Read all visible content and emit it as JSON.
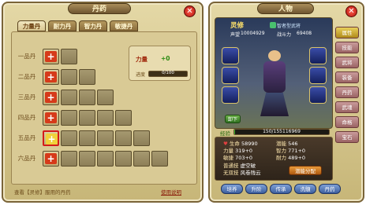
{
  "left_panel": {
    "title": "丹药",
    "tabs": [
      "力量丹",
      "耐力丹",
      "智力丹",
      "敏捷丹"
    ],
    "rows": [
      "一品丹",
      "二品丹",
      "三品丹",
      "四品丹",
      "五品丹",
      "六品丹"
    ],
    "info": {
      "attr_label": "力量",
      "attr_value": "+0",
      "progress_label": "进度",
      "progress_value": "0/100",
      "progress_fraction": 0
    },
    "footer_text": "查看【灵修】服用的丹药",
    "footer_link": "使用说明"
  },
  "right_panel": {
    "title": "人物",
    "char_name": "灵修",
    "prestige_label": "声望",
    "prestige_value": "10004929",
    "class_name": "智者型武将",
    "combat_label": "战斗力",
    "combat_value": "69408",
    "exp_label": "经验",
    "exp_value": "150/155116969",
    "exp_fraction": 1e-06,
    "stats": [
      {
        "label": "生命",
        "value": "58990"
      },
      {
        "label": "潜能",
        "value": "546"
      },
      {
        "label": "力量",
        "value": "319+0"
      },
      {
        "label": "智力",
        "value": "771+0"
      },
      {
        "label": "敏捷",
        "value": "703+0"
      },
      {
        "label": "耐力",
        "value": "489+0"
      }
    ],
    "skill1_label": "普通技",
    "skill1_value": "虚空破",
    "skill2_label": "无双技",
    "skill2_value": "风卷残云",
    "reallocate_button": "潜能分配",
    "equip_button": "卸下",
    "side_buttons": [
      "属性",
      "技能",
      "武将",
      "装备",
      "丹药",
      "武魂",
      "命格",
      "宝石"
    ],
    "bottom_buttons": [
      "培养",
      "升阶",
      "传承",
      "洗髓",
      "丹药"
    ]
  }
}
